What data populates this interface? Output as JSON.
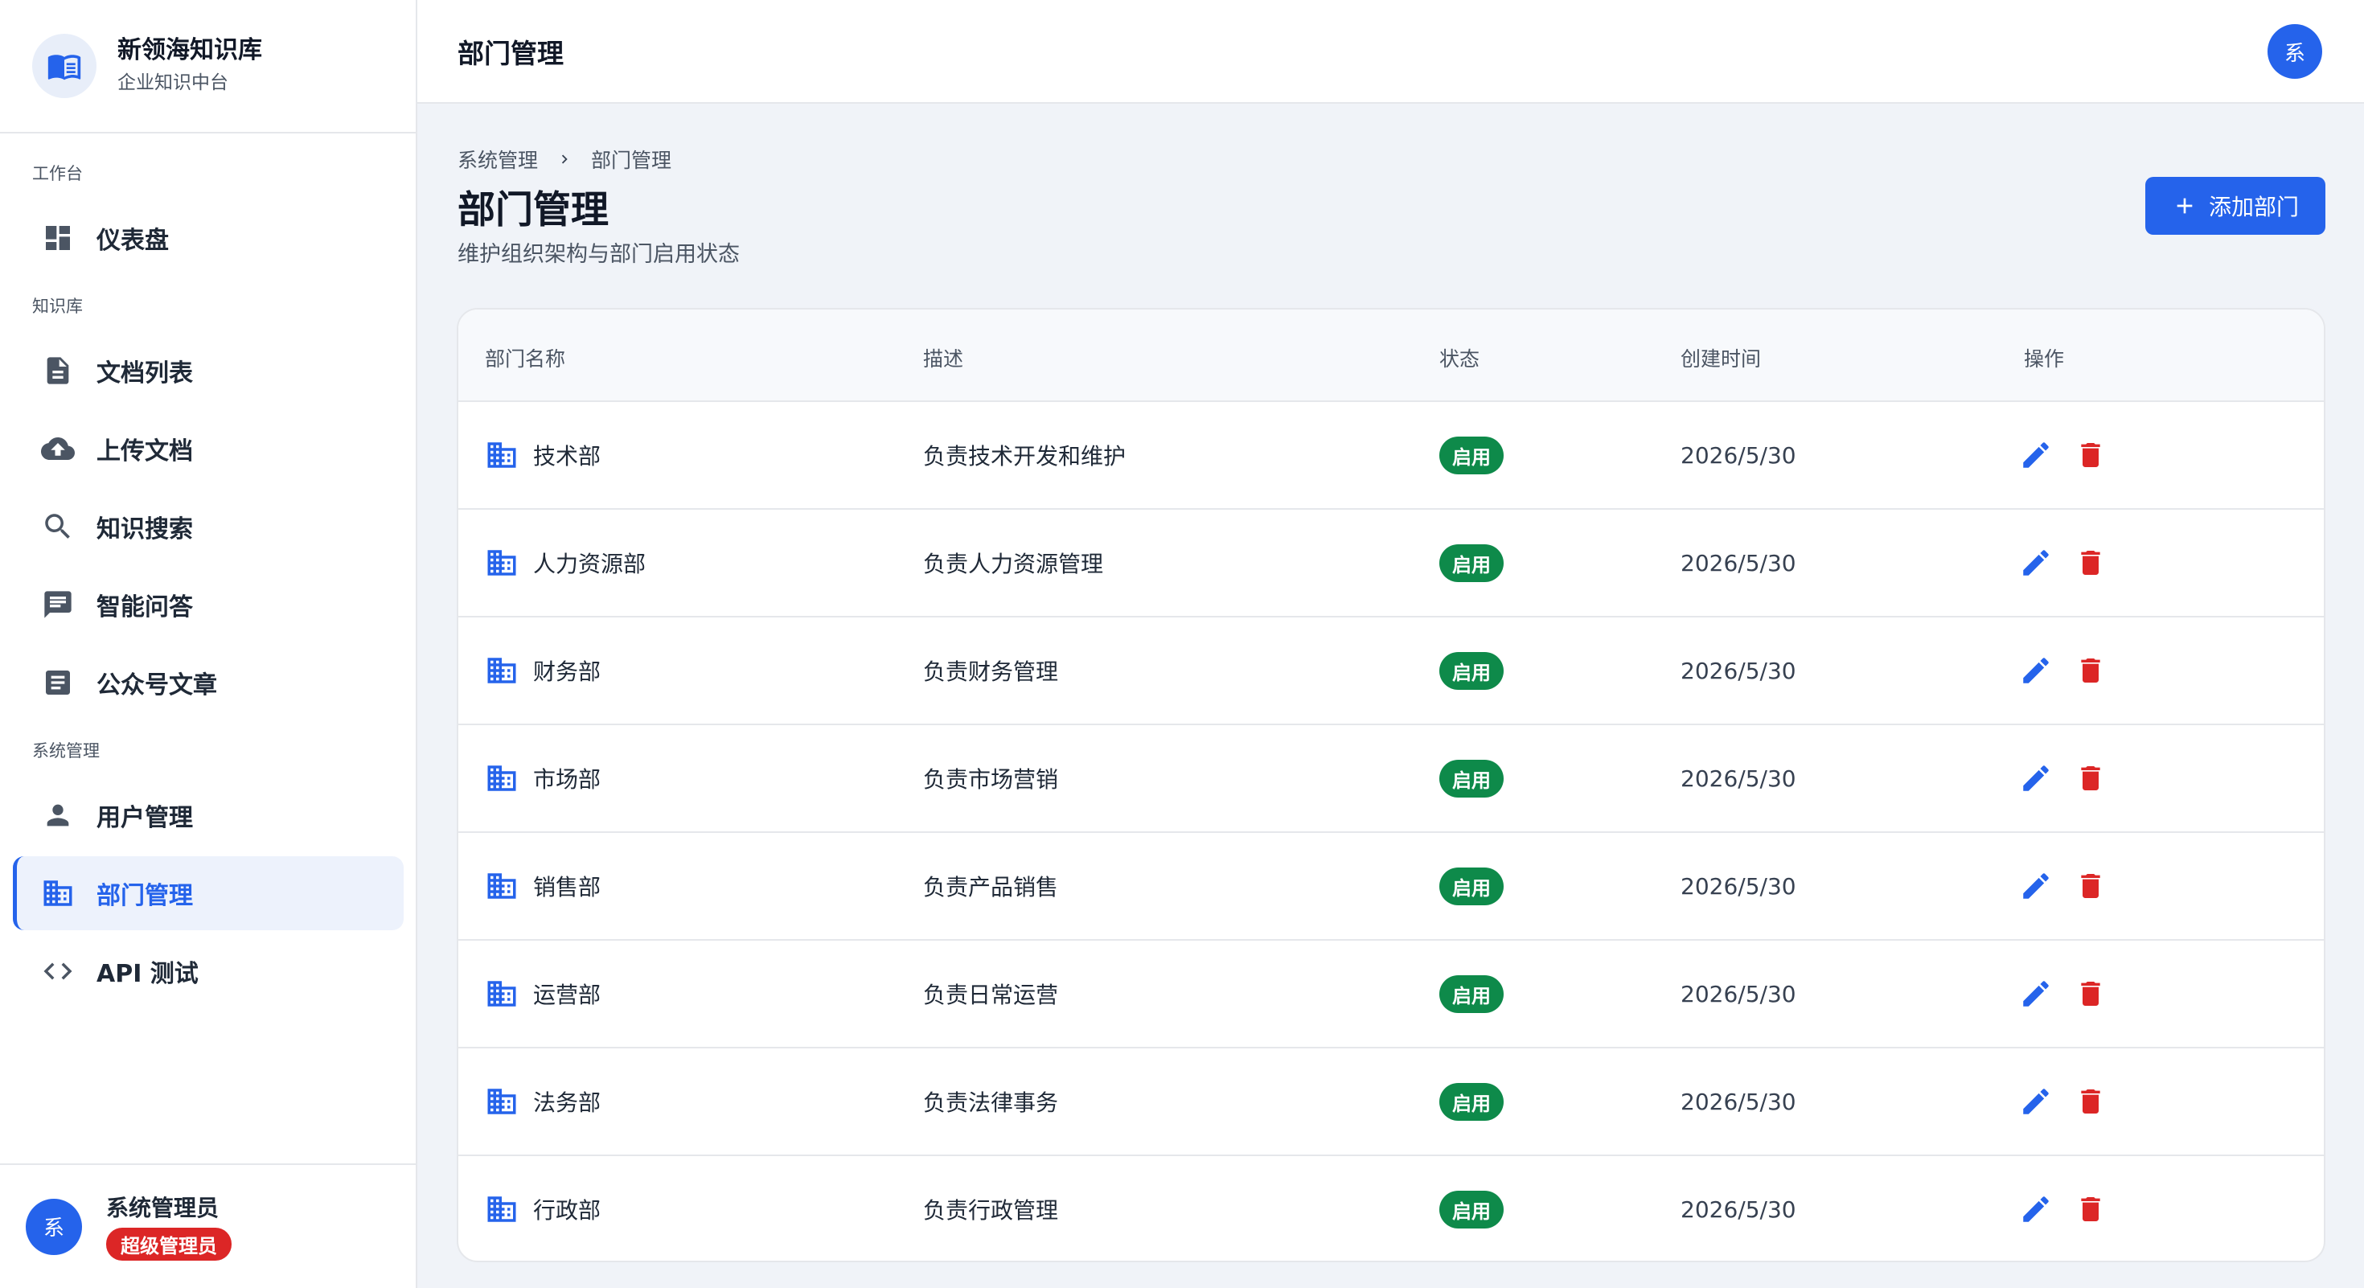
{
  "brand": {
    "name": "新领海知识库",
    "subtitle": "企业知识中台"
  },
  "nav": {
    "sections": {
      "workbench": "工作台",
      "knowledge": "知识库",
      "system": "系统管理"
    },
    "items": [
      {
        "label": "仪表盘",
        "icon": "dashboard-icon"
      },
      {
        "label": "文档列表",
        "icon": "document-icon"
      },
      {
        "label": "上传文档",
        "icon": "cloud-upload-icon"
      },
      {
        "label": "知识搜索",
        "icon": "search-icon"
      },
      {
        "label": "智能问答",
        "icon": "chat-icon"
      },
      {
        "label": "公众号文章",
        "icon": "article-icon"
      },
      {
        "label": "用户管理",
        "icon": "person-icon"
      },
      {
        "label": "部门管理",
        "icon": "building-icon",
        "active": true
      },
      {
        "label": "API 测试",
        "icon": "code-icon"
      }
    ]
  },
  "user": {
    "avatar_text": "系",
    "name": "系统管理员",
    "role": "超级管理员"
  },
  "topbar": {
    "title": "部门管理",
    "avatar_text": "系"
  },
  "breadcrumb": {
    "parent": "系统管理",
    "current": "部门管理"
  },
  "page": {
    "title": "部门管理",
    "subtitle": "维护组织架构与部门启用状态",
    "add_button": "添加部门"
  },
  "table": {
    "headers": {
      "name": "部门名称",
      "desc": "描述",
      "status": "状态",
      "created": "创建时间",
      "actions": "操作"
    },
    "rows": [
      {
        "name": "技术部",
        "desc": "负责技术开发和维护",
        "status": "启用",
        "created": "2026/5/30"
      },
      {
        "name": "人力资源部",
        "desc": "负责人力资源管理",
        "status": "启用",
        "created": "2026/5/30"
      },
      {
        "name": "财务部",
        "desc": "负责财务管理",
        "status": "启用",
        "created": "2026/5/30"
      },
      {
        "name": "市场部",
        "desc": "负责市场营销",
        "status": "启用",
        "created": "2026/5/30"
      },
      {
        "name": "销售部",
        "desc": "负责产品销售",
        "status": "启用",
        "created": "2026/5/30"
      },
      {
        "name": "运营部",
        "desc": "负责日常运营",
        "status": "启用",
        "created": "2026/5/30"
      },
      {
        "name": "法务部",
        "desc": "负责法律事务",
        "status": "启用",
        "created": "2026/5/30"
      },
      {
        "name": "行政部",
        "desc": "负责行政管理",
        "status": "启用",
        "created": "2026/5/30"
      }
    ]
  },
  "colors": {
    "primary": "#2563eb",
    "danger": "#dc2626",
    "success": "#0e8a4a",
    "icon_gray": "#4b5563"
  }
}
